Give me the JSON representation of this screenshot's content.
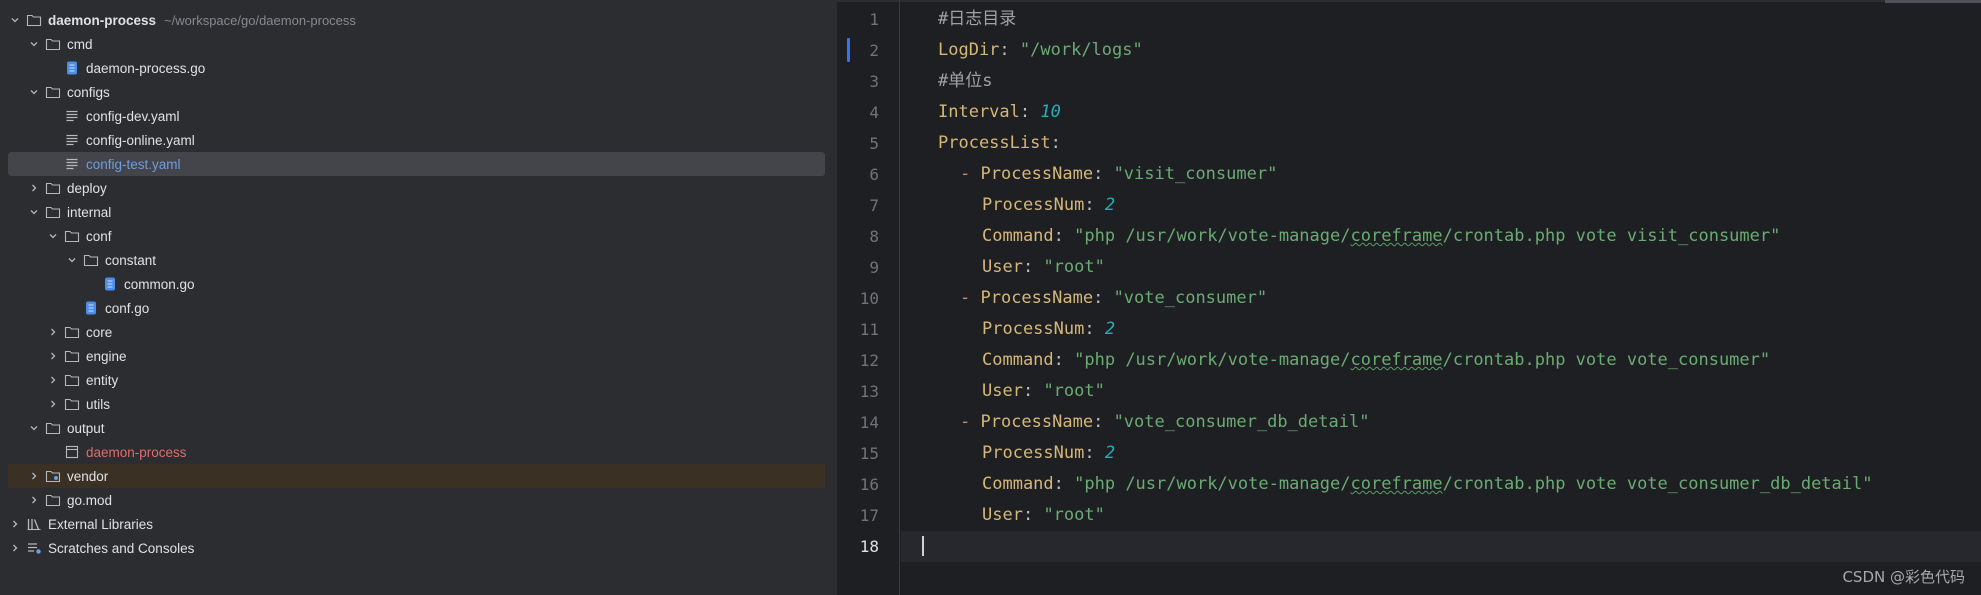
{
  "tree": {
    "rows": [
      {
        "name": "daemon-process",
        "path": "~/workspace/go/daemon-process"
      },
      {
        "name": "cmd"
      },
      {
        "name": "daemon-process.go"
      },
      {
        "name": "configs"
      },
      {
        "name": "config-dev.yaml"
      },
      {
        "name": "config-online.yaml"
      },
      {
        "name": "config-test.yaml"
      },
      {
        "name": "deploy"
      },
      {
        "name": "internal"
      },
      {
        "name": "conf"
      },
      {
        "name": "constant"
      },
      {
        "name": "common.go"
      },
      {
        "name": "conf.go"
      },
      {
        "name": "core"
      },
      {
        "name": "engine"
      },
      {
        "name": "entity"
      },
      {
        "name": "utils"
      },
      {
        "name": "output"
      },
      {
        "name": "daemon-process"
      },
      {
        "name": "vendor"
      },
      {
        "name": "go.mod"
      },
      {
        "name": "External Libraries"
      },
      {
        "name": "Scratches and Consoles"
      }
    ]
  },
  "editor": {
    "line_numbers": [
      "1",
      "2",
      "3",
      "4",
      "5",
      "6",
      "7",
      "8",
      "9",
      "10",
      "11",
      "12",
      "13",
      "14",
      "15",
      "16",
      "17",
      "18"
    ],
    "lines": [
      {
        "t1": "#日志目录"
      },
      {
        "k": "LogDir",
        "sep": ": ",
        "v": "\"/work/logs\""
      },
      {
        "t1": "#单位s"
      },
      {
        "k": "Interval",
        "sep": ": ",
        "v": "10"
      },
      {
        "k": "ProcessList",
        "sep": ":"
      },
      {
        "d": "- ",
        "k": "ProcessName",
        "sep": ": ",
        "v": "\"visit_consumer\""
      },
      {
        "k": "ProcessNum",
        "sep": ": ",
        "v": "2"
      },
      {
        "k": "Command",
        "sep": ": ",
        "v1": "\"php /usr/work/vote-manage/",
        "u": "coreframe",
        "v2": "/crontab.php vote visit_consumer\""
      },
      {
        "k": "User",
        "sep": ": ",
        "v": "\"root\""
      },
      {
        "d": "- ",
        "k": "ProcessName",
        "sep": ": ",
        "v": "\"vote_consumer\""
      },
      {
        "k": "ProcessNum",
        "sep": ": ",
        "v": "2"
      },
      {
        "k": "Command",
        "sep": ": ",
        "v1": "\"php /usr/work/vote-manage/",
        "u": "coreframe",
        "v2": "/crontab.php vote vote_consumer\""
      },
      {
        "k": "User",
        "sep": ": ",
        "v": "\"root\""
      },
      {
        "d": "- ",
        "k": "ProcessName",
        "sep": ": ",
        "v": "\"vote_consumer_db_detail\""
      },
      {
        "k": "ProcessNum",
        "sep": ": ",
        "v": "2"
      },
      {
        "k": "Command",
        "sep": ": ",
        "v1": "\"php /usr/work/vote-manage/",
        "u": "coreframe",
        "v2": "/crontab.php vote vote_consumer_db_detail\""
      },
      {
        "k": "User",
        "sep": ": ",
        "v": "\"root\""
      },
      {}
    ]
  },
  "watermark": "CSDN @彩色代码",
  "colors": {
    "tree_bg": "#2b2d30",
    "editor_bg": "#1e1f22",
    "selection": "#43454a",
    "yaml_key": "#d5b778",
    "yaml_string": "#6aab73",
    "yaml_number": "#2aacb8",
    "link_blue": "#6d9de3",
    "error_red": "#e06c6c"
  }
}
